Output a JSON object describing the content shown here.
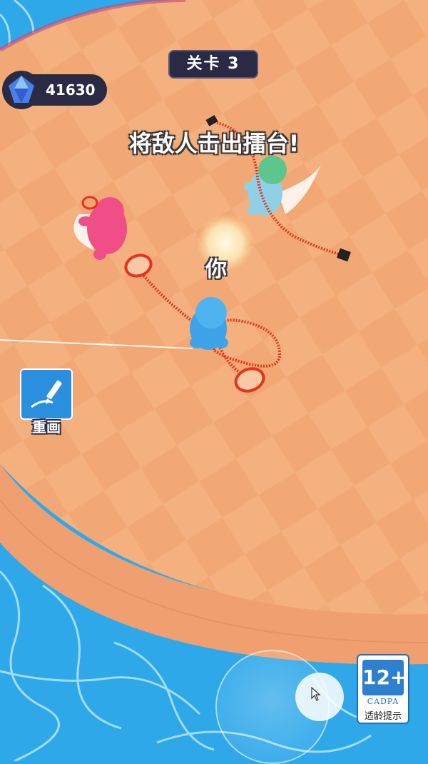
{
  "hud": {
    "level_label": "关卡 3",
    "gem_count": "41630",
    "gem_icon": "gem-icon"
  },
  "instruction": "将敌人击出擂台!",
  "player_label": "你",
  "redraw": {
    "label": "重画",
    "icon": "pen-draw-icon"
  },
  "age_rating": {
    "rating": "12+",
    "org": "CADPA",
    "hint": "适龄提示"
  },
  "colors": {
    "arena": "#f4b07e",
    "arena_dark": "#e99a6a",
    "water": "#2fa8ea",
    "rope": "#e8321c",
    "player": "#3ea3e8",
    "enemy_pink": "#f04e86",
    "enemy_green": "#5cc68e"
  }
}
